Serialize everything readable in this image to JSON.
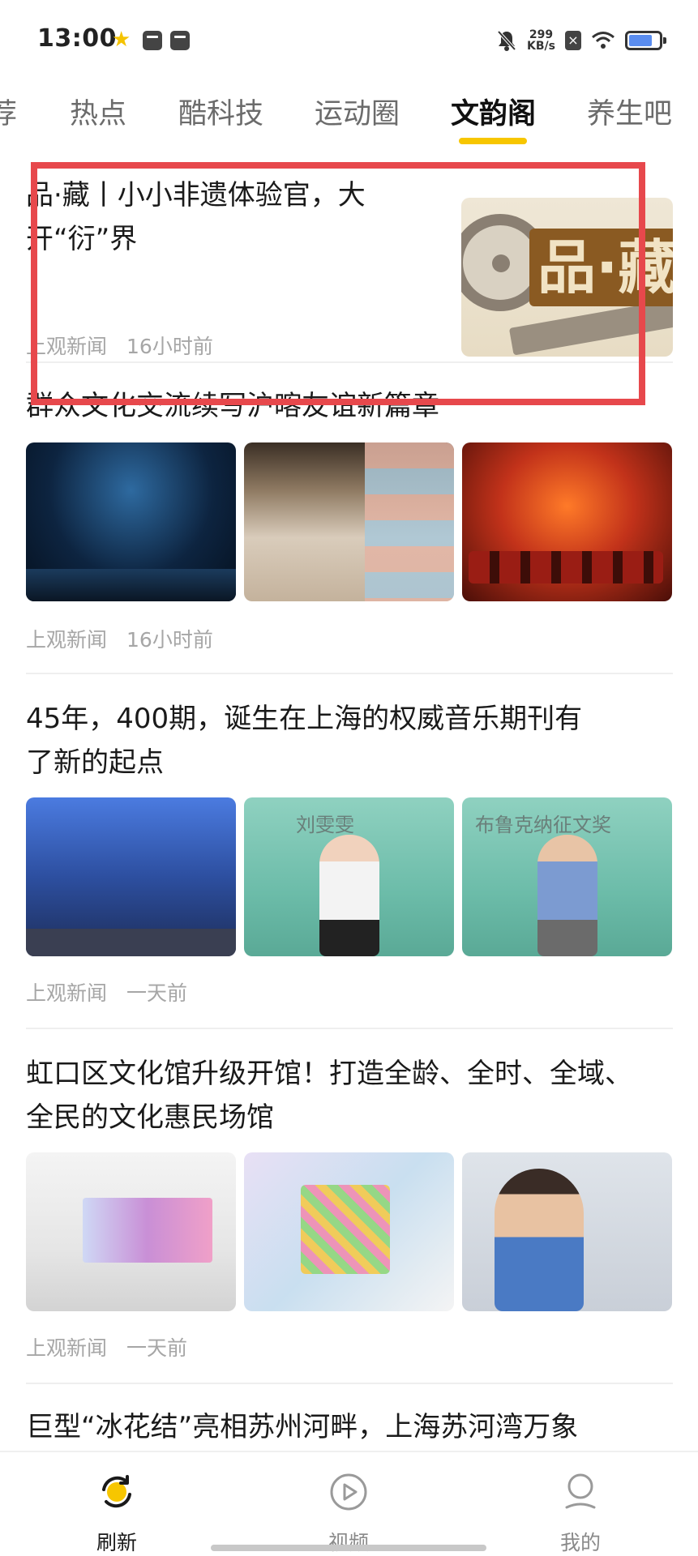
{
  "status_bar": {
    "time": "13:00",
    "speed_value": "299",
    "speed_unit": "KB/s",
    "icons": [
      "star-icon",
      "notification-box-icon",
      "notification-box-icon",
      "mute-bell-icon",
      "sim-off-icon",
      "wifi-icon",
      "battery-icon"
    ]
  },
  "tabs": [
    {
      "label": "荐",
      "active": false
    },
    {
      "label": "热点",
      "active": false
    },
    {
      "label": "酷科技",
      "active": false
    },
    {
      "label": "运动圈",
      "active": false
    },
    {
      "label": "文韵阁",
      "active": true
    },
    {
      "label": "养生吧",
      "active": false
    }
  ],
  "accent_color": "#f7c600",
  "highlight_color": "#e7484c",
  "articles": [
    {
      "title_line1": "品·藏丨小小非遗体验官，大",
      "title_line2": "开“衍”界",
      "source": "上观新闻",
      "time": "16小时前",
      "thumbnail_text": "品·藏"
    },
    {
      "title": "群众文化交流续写沪喀友谊新篇章",
      "source": "上观新闻",
      "time": "16小时前"
    },
    {
      "title_line1": "45年，400期，诞生在上海的权威音乐期刊有",
      "title_line2": "了新的起点",
      "source": "上观新闻",
      "time": "一天前",
      "image_texts": [
        "刘雯雯",
        "布鲁克纳征文奖"
      ]
    },
    {
      "title_line1": "虹口区文化馆升级开馆！打造全龄、全时、全域、",
      "title_line2": "全民的文化惠民场馆",
      "source": "上观新闻",
      "time": "一天前"
    },
    {
      "title": "巨型“冰花结”亮相苏州河畔，上海苏河湾万象"
    }
  ],
  "bottom_nav": [
    {
      "label": "刷新",
      "icon": "refresh-icon",
      "active": true
    },
    {
      "label": "视频",
      "icon": "play-circle-icon",
      "active": false
    },
    {
      "label": "我的",
      "icon": "user-icon",
      "active": false
    }
  ]
}
